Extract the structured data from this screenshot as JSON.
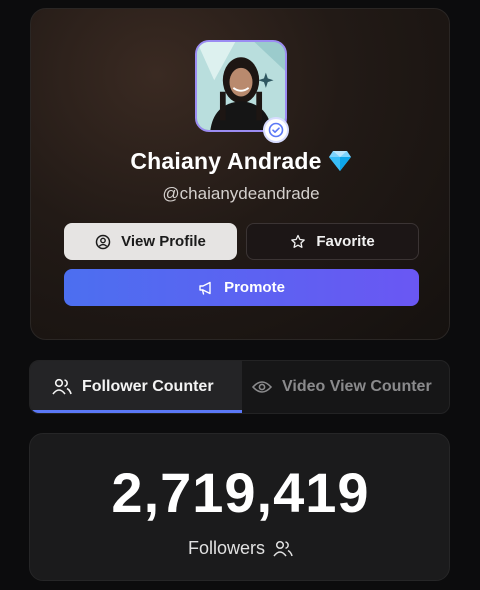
{
  "profile": {
    "name": "Chaiany Andrade",
    "handle": "@chaianydeandrade",
    "verified": true,
    "badge_icon": "diamond-icon"
  },
  "actions": {
    "view_profile_label": "View Profile",
    "favorite_label": "Favorite",
    "promote_label": "Promote"
  },
  "tabs": [
    {
      "label": "Follower Counter",
      "icon": "users-icon",
      "active": true
    },
    {
      "label": "Video View Counter",
      "icon": "eye-icon",
      "active": false
    }
  ],
  "counter": {
    "value": "2,719,419",
    "label": "Followers",
    "icon": "users-icon"
  },
  "colors": {
    "accent": "#5b78f6",
    "promote_start": "#4c6ff0",
    "promote_end": "#6a57f3",
    "background": "#0c0c0d"
  }
}
